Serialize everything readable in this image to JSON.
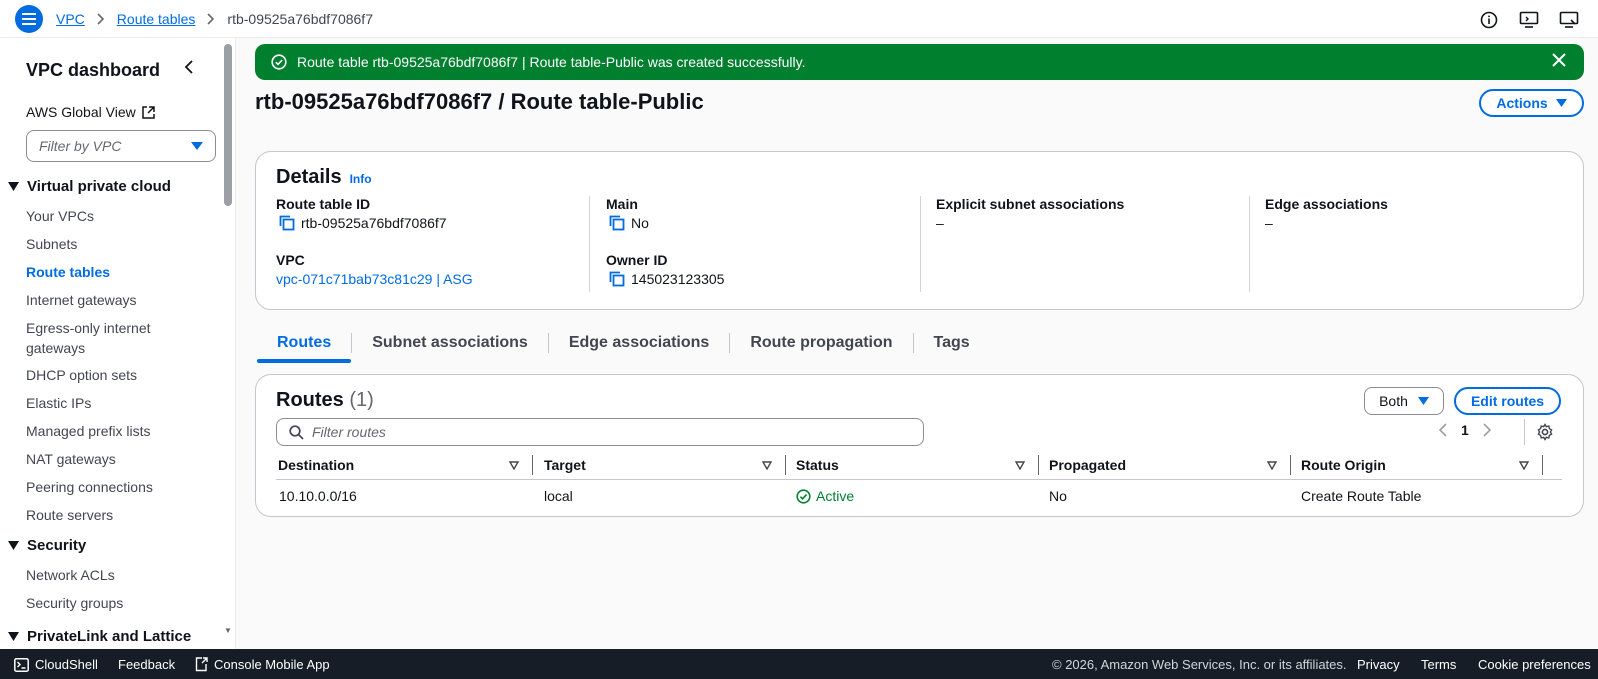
{
  "header": {
    "breadcrumb": [
      "VPC",
      "Route tables",
      "rtb-09525a76bdf7086f7"
    ],
    "icons": [
      "info-icon",
      "feedback-icon",
      "console-icon"
    ]
  },
  "sidebar": {
    "title": "VPC dashboard",
    "global_view": "AWS Global View",
    "filter_placeholder": "Filter by VPC",
    "sections": [
      {
        "label": "Virtual private cloud",
        "items": [
          "Your VPCs",
          "Subnets",
          "Route tables",
          "Internet gateways",
          "Egress-only internet gateways",
          "DHCP option sets",
          "Elastic IPs",
          "Managed prefix lists",
          "NAT gateways",
          "Peering connections",
          "Route servers"
        ]
      },
      {
        "label": "Security",
        "items": [
          "Network ACLs",
          "Security groups"
        ]
      },
      {
        "label": "PrivateLink and Lattice",
        "items": []
      }
    ],
    "active_item": "Route tables"
  },
  "flash": {
    "message": "Route table rtb-09525a76bdf7086f7 | Route table-Public was created successfully."
  },
  "page": {
    "title": "rtb-09525a76bdf7086f7 / Route table-Public",
    "actions_label": "Actions"
  },
  "details": {
    "title": "Details",
    "info": "Info",
    "route_table_id_label": "Route table ID",
    "route_table_id": "rtb-09525a76bdf7086f7",
    "vpc_label": "VPC",
    "vpc_value": "vpc-071c71bab73c81c29 | ASG",
    "main_label": "Main",
    "main_value": "No",
    "owner_label": "Owner ID",
    "owner_value": "145023123305",
    "explicit_label": "Explicit subnet associations",
    "explicit_value": "–",
    "edge_label": "Edge associations",
    "edge_value": "–"
  },
  "tabs": [
    "Routes",
    "Subnet associations",
    "Edge associations",
    "Route propagation",
    "Tags"
  ],
  "routes": {
    "title": "Routes",
    "count": "(1)",
    "filter_label": "Both",
    "edit_label": "Edit routes",
    "search_placeholder": "Filter routes",
    "page_number": "1",
    "columns": [
      "Destination",
      "Target",
      "Status",
      "Propagated",
      "Route Origin"
    ],
    "rows": [
      {
        "destination": "10.10.0.0/16",
        "target": "local",
        "status": "Active",
        "propagated": "No",
        "origin": "Create Route Table"
      }
    ]
  },
  "footer": {
    "cloudshell": "CloudShell",
    "feedback": "Feedback",
    "mobile": "Console Mobile App",
    "copyright": "© 2026, Amazon Web Services, Inc. or its affiliates.",
    "privacy": "Privacy",
    "terms": "Terms",
    "cookies": "Cookie preferences"
  },
  "colors": {
    "accent": "#006ce0",
    "success": "#00802f",
    "footer_bg": "#161d26"
  }
}
